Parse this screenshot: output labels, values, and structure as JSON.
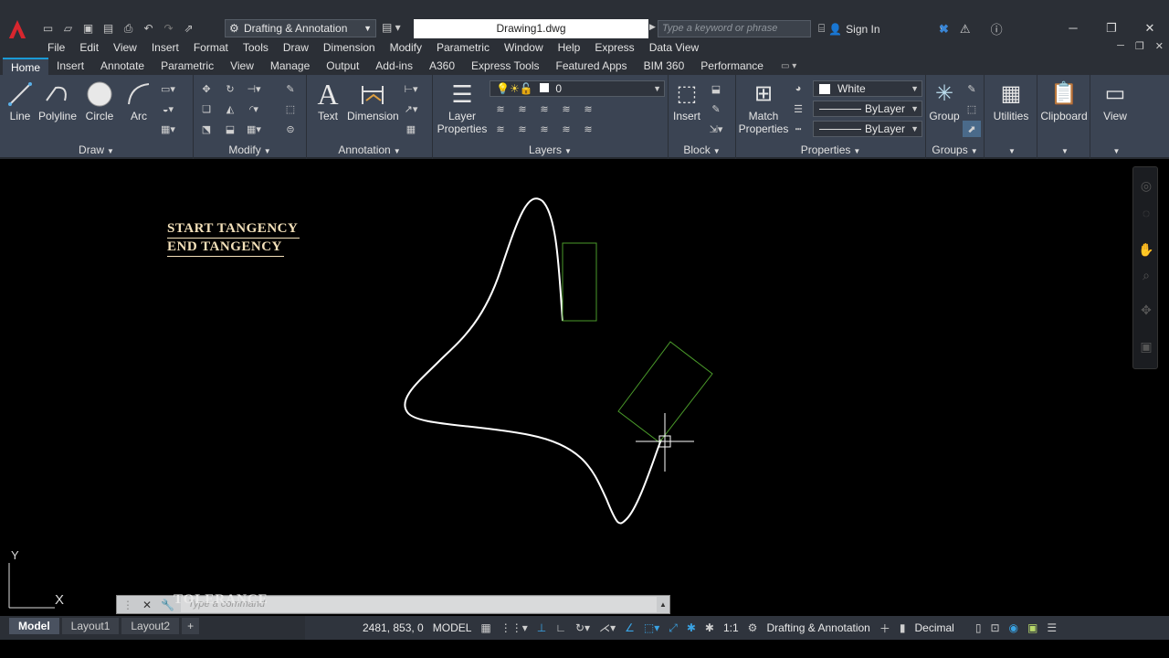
{
  "title_bar": {
    "workspace": "Drafting & Annotation",
    "document": "Drawing1.dwg",
    "search_placeholder": "Type a keyword or phrase",
    "sign_in": "Sign In"
  },
  "menu": [
    "File",
    "Edit",
    "View",
    "Insert",
    "Format",
    "Tools",
    "Draw",
    "Dimension",
    "Modify",
    "Parametric",
    "Window",
    "Help",
    "Express",
    "Data View"
  ],
  "tabs": [
    "Home",
    "Insert",
    "Annotate",
    "Parametric",
    "View",
    "Manage",
    "Output",
    "Add-ins",
    "A360",
    "Express Tools",
    "Featured Apps",
    "BIM 360",
    "Performance"
  ],
  "ribbon": {
    "draw": {
      "title": "Draw",
      "line": "Line",
      "polyline": "Polyline",
      "circle": "Circle",
      "arc": "Arc"
    },
    "modify": {
      "title": "Modify"
    },
    "annotation": {
      "title": "Annotation",
      "text": "Text",
      "dimension": "Dimension"
    },
    "layers": {
      "title": "Layers",
      "layer_properties_1": "Layer",
      "layer_properties_2": "Properties",
      "current_layer": "0"
    },
    "block": {
      "title": "Block",
      "insert": "Insert"
    },
    "properties": {
      "title": "Properties",
      "match_1": "Match",
      "match_2": "Properties",
      "color": "White",
      "linetype": "ByLayer",
      "lineweight": "ByLayer"
    },
    "groups": {
      "title": "Groups",
      "group": "Group"
    },
    "utilities": "Utilities",
    "clipboard": "Clipboard",
    "view": "View"
  },
  "drawing": {
    "annotation_line1": "START TANGENCY",
    "annotation_line2": "END TANGENCY",
    "ucs_y": "Y",
    "ucs_x": "X",
    "colors": {
      "curve": "#ffffff",
      "rect": "#4a9a2a",
      "text": "#f3e0b9"
    }
  },
  "command_line": {
    "placeholder": "Type a command",
    "ghost_text": "TOLERANCE"
  },
  "status": {
    "layout_tabs": [
      "Model",
      "Layout1",
      "Layout2"
    ],
    "coordinates": "2481, 853, 0",
    "space": "MODEL",
    "scale": "1:1",
    "workspace": "Drafting & Annotation",
    "units": "Decimal"
  }
}
